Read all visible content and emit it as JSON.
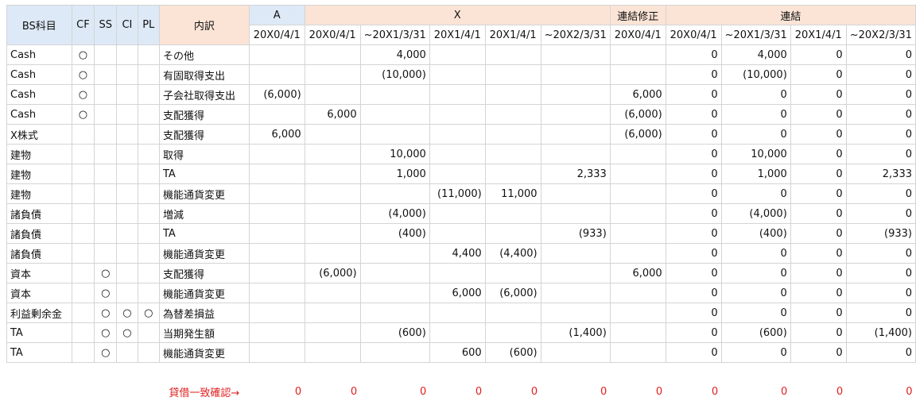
{
  "header": {
    "bs": "BS科目",
    "cf": "CF",
    "ss": "SS",
    "ci": "CI",
    "pl": "PL",
    "naiyaku": "内訳",
    "groupA": "A",
    "groupX": "X",
    "groupAdj": "連結修正",
    "groupCons": "連結",
    "dates": [
      "20X0/4/1",
      "20X0/4/1",
      "~20X1/3/31",
      "20X1/4/1",
      "20X1/4/1",
      "~20X2/3/31",
      "20X0/4/1",
      "20X0/4/1",
      "~20X1/3/31",
      "20X1/4/1",
      "~20X2/3/31"
    ]
  },
  "mark_symbol": "○",
  "rows": [
    {
      "bs": "Cash",
      "cf": "○",
      "ss": "",
      "ci": "",
      "pl": "",
      "naiyaku": "その他",
      "v": [
        "",
        "",
        "4,000",
        "",
        "",
        "",
        "",
        "0",
        "4,000",
        "0",
        "0"
      ]
    },
    {
      "bs": "Cash",
      "cf": "○",
      "ss": "",
      "ci": "",
      "pl": "",
      "naiyaku": "有固取得支出",
      "v": [
        "",
        "",
        "(10,000)",
        "",
        "",
        "",
        "",
        "0",
        "(10,000)",
        "0",
        "0"
      ]
    },
    {
      "bs": "Cash",
      "cf": "○",
      "ss": "",
      "ci": "",
      "pl": "",
      "naiyaku": "子会社取得支出",
      "v": [
        "(6,000)",
        "",
        "",
        "",
        "",
        "",
        "6,000",
        "0",
        "0",
        "0",
        "0"
      ]
    },
    {
      "bs": "Cash",
      "cf": "○",
      "ss": "",
      "ci": "",
      "pl": "",
      "naiyaku": "支配獲得",
      "v": [
        "",
        "6,000",
        "",
        "",
        "",
        "",
        "(6,000)",
        "0",
        "0",
        "0",
        "0"
      ]
    },
    {
      "bs": "X株式",
      "cf": "",
      "ss": "",
      "ci": "",
      "pl": "",
      "naiyaku": "支配獲得",
      "v": [
        "6,000",
        "",
        "",
        "",
        "",
        "",
        "(6,000)",
        "0",
        "0",
        "0",
        "0"
      ]
    },
    {
      "bs": "建物",
      "cf": "",
      "ss": "",
      "ci": "",
      "pl": "",
      "naiyaku": "取得",
      "v": [
        "",
        "",
        "10,000",
        "",
        "",
        "",
        "",
        "0",
        "10,000",
        "0",
        "0"
      ]
    },
    {
      "bs": "建物",
      "cf": "",
      "ss": "",
      "ci": "",
      "pl": "",
      "naiyaku": "TA",
      "v": [
        "",
        "",
        "1,000",
        "",
        "",
        "2,333",
        "",
        "0",
        "1,000",
        "0",
        "2,333"
      ]
    },
    {
      "bs": "建物",
      "cf": "",
      "ss": "",
      "ci": "",
      "pl": "",
      "naiyaku": "機能通貨変更",
      "v": [
        "",
        "",
        "",
        "(11,000)",
        "11,000",
        "",
        "",
        "0",
        "0",
        "0",
        "0"
      ]
    },
    {
      "bs": "諸負債",
      "cf": "",
      "ss": "",
      "ci": "",
      "pl": "",
      "naiyaku": "増減",
      "v": [
        "",
        "",
        "(4,000)",
        "",
        "",
        "",
        "",
        "0",
        "(4,000)",
        "0",
        "0"
      ]
    },
    {
      "bs": "諸負債",
      "cf": "",
      "ss": "",
      "ci": "",
      "pl": "",
      "naiyaku": "TA",
      "v": [
        "",
        "",
        "(400)",
        "",
        "",
        "(933)",
        "",
        "0",
        "(400)",
        "0",
        "(933)"
      ]
    },
    {
      "bs": "諸負債",
      "cf": "",
      "ss": "",
      "ci": "",
      "pl": "",
      "naiyaku": "機能通貨変更",
      "v": [
        "",
        "",
        "",
        "4,400",
        "(4,400)",
        "",
        "",
        "0",
        "0",
        "0",
        "0"
      ]
    },
    {
      "bs": "資本",
      "cf": "",
      "ss": "○",
      "ci": "",
      "pl": "",
      "naiyaku": "支配獲得",
      "v": [
        "",
        "(6,000)",
        "",
        "",
        "",
        "",
        "6,000",
        "0",
        "0",
        "0",
        "0"
      ]
    },
    {
      "bs": "資本",
      "cf": "",
      "ss": "○",
      "ci": "",
      "pl": "",
      "naiyaku": "機能通貨変更",
      "v": [
        "",
        "",
        "",
        "6,000",
        "(6,000)",
        "",
        "",
        "0",
        "0",
        "0",
        "0"
      ]
    },
    {
      "bs": "利益剰余金",
      "cf": "",
      "ss": "○",
      "ci": "○",
      "pl": "○",
      "naiyaku": "為替差損益",
      "v": [
        "",
        "",
        "",
        "",
        "",
        "",
        "",
        "0",
        "0",
        "0",
        "0"
      ]
    },
    {
      "bs": "TA",
      "cf": "",
      "ss": "○",
      "ci": "○",
      "pl": "",
      "naiyaku": "当期発生額",
      "v": [
        "",
        "",
        "(600)",
        "",
        "",
        "(1,400)",
        "",
        "0",
        "(600)",
        "0",
        "(1,400)"
      ]
    },
    {
      "bs": "TA",
      "cf": "",
      "ss": "○",
      "ci": "",
      "pl": "",
      "naiyaku": "機能通貨変更",
      "v": [
        "",
        "",
        "",
        "600",
        "(600)",
        "",
        "",
        "0",
        "0",
        "0",
        "0"
      ]
    }
  ],
  "check": {
    "label": "貸借一致確認→",
    "values": [
      "0",
      "0",
      "0",
      "0",
      "0",
      "0",
      "0",
      "0",
      "0",
      "0",
      "0"
    ]
  }
}
